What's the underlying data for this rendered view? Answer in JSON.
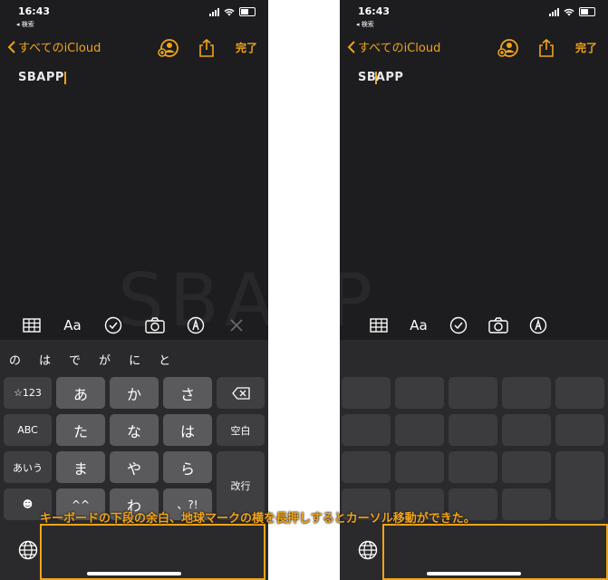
{
  "status": {
    "time": "16:43",
    "back_label": "◂ 検索"
  },
  "nav": {
    "back_label": "すべてのiCloud",
    "done_label": "完了"
  },
  "note": {
    "left_text": "SBAPP",
    "right_text_a": "SB",
    "right_text_b": "APP"
  },
  "candidates": [
    "の",
    "は",
    "で",
    "が",
    "に",
    "と"
  ],
  "keys": {
    "numbers": "☆123",
    "abc": "ABC",
    "kana_mode": "あいう",
    "row1": [
      "あ",
      "か",
      "さ"
    ],
    "row2": [
      "た",
      "な",
      "は"
    ],
    "row3": [
      "ま",
      "や",
      "ら"
    ],
    "row4": [
      "^^",
      "わ",
      "、?!"
    ],
    "space": "空白",
    "enter": "改行",
    "emoji": "☻"
  },
  "caption": "キーボードの下段の余白、地球マークの横を長押しするとカーソル移動ができた。",
  "colors": {
    "accent": "#f0a41a",
    "background": "#1d1d1f",
    "keyboard": "#2a2a2c"
  }
}
